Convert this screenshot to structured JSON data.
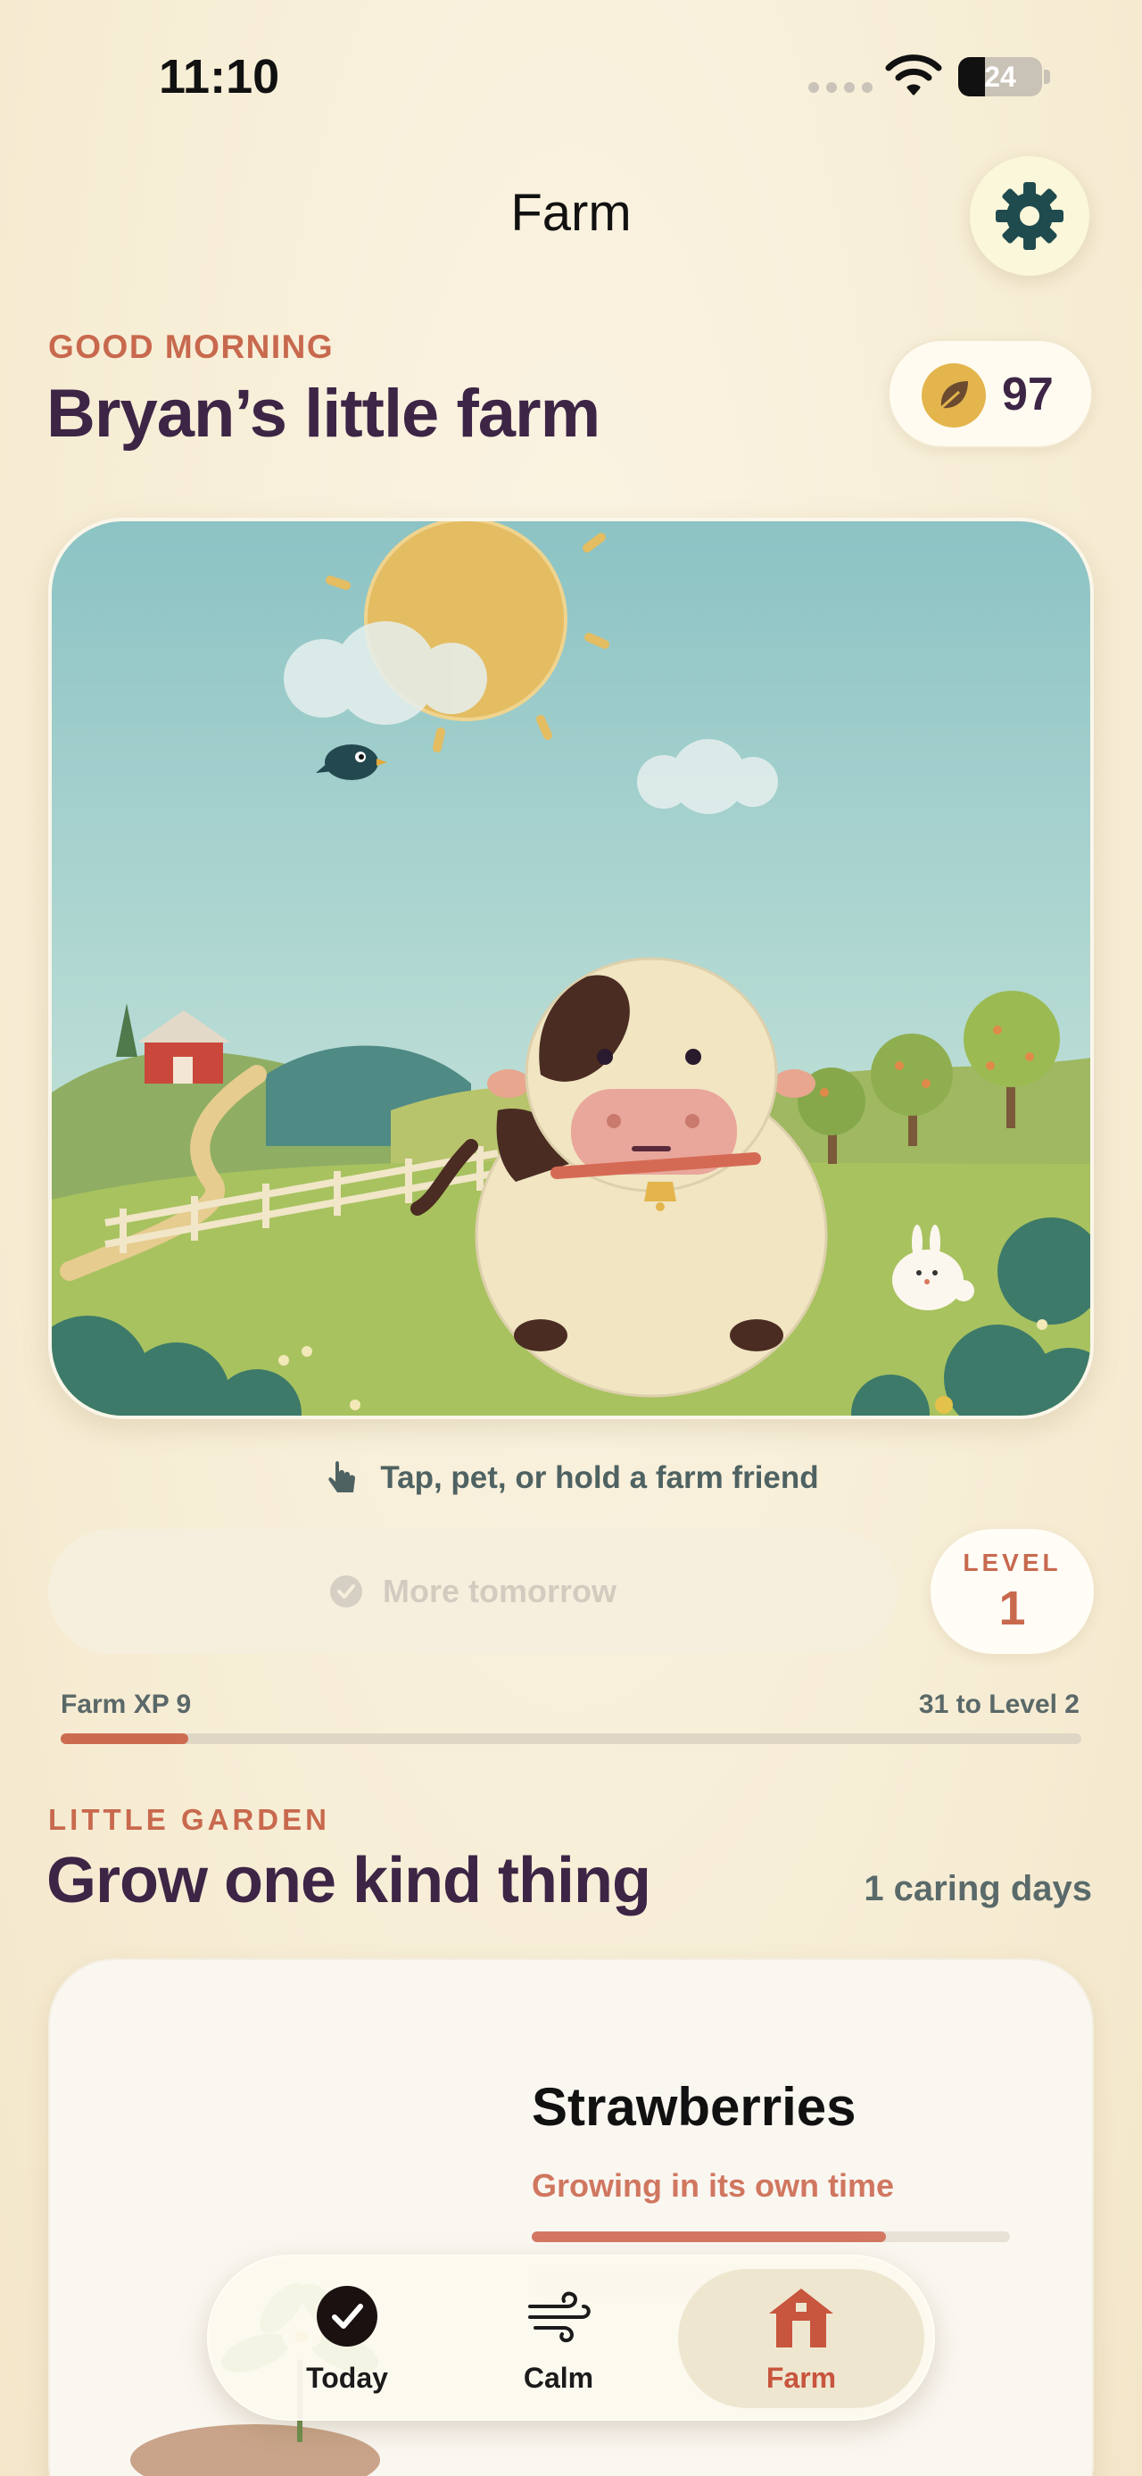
{
  "status_bar": {
    "time": "11:10",
    "battery": "24"
  },
  "header": {
    "title": "Farm",
    "settings_icon": "gear-icon"
  },
  "greeting": "GOOD MORNING",
  "farm_name": "Bryan’s little farm",
  "coins": {
    "icon": "leaf-coin-icon",
    "value": "97"
  },
  "scene": {
    "hint": "Tap, pet, or hold a farm friend",
    "hint_icon": "hand-tap-icon"
  },
  "action": {
    "label": "More tomorrow",
    "icon": "check-circle-icon"
  },
  "level": {
    "label": "LEVEL",
    "value": "1"
  },
  "xp": {
    "label": "Farm XP 9",
    "remaining": "31 to Level 2",
    "progress": 0.125
  },
  "garden": {
    "section_label": "LITTLE GARDEN",
    "title": "Grow one kind thing",
    "caring_days": "1 caring days",
    "plant_name": "Strawberries",
    "plant_status": "Growing in its own time",
    "plant_progress": 0.74
  },
  "tabs": [
    {
      "label": "Today",
      "icon": "check-circle-icon",
      "active": false
    },
    {
      "label": "Calm",
      "icon": "wind-icon",
      "active": false
    },
    {
      "label": "Farm",
      "icon": "barn-icon",
      "active": true
    }
  ],
  "colors": {
    "accent": "#c8694e",
    "heading": "#3d2546",
    "gear": "#1f4b4f",
    "background": "#f8efd9"
  }
}
